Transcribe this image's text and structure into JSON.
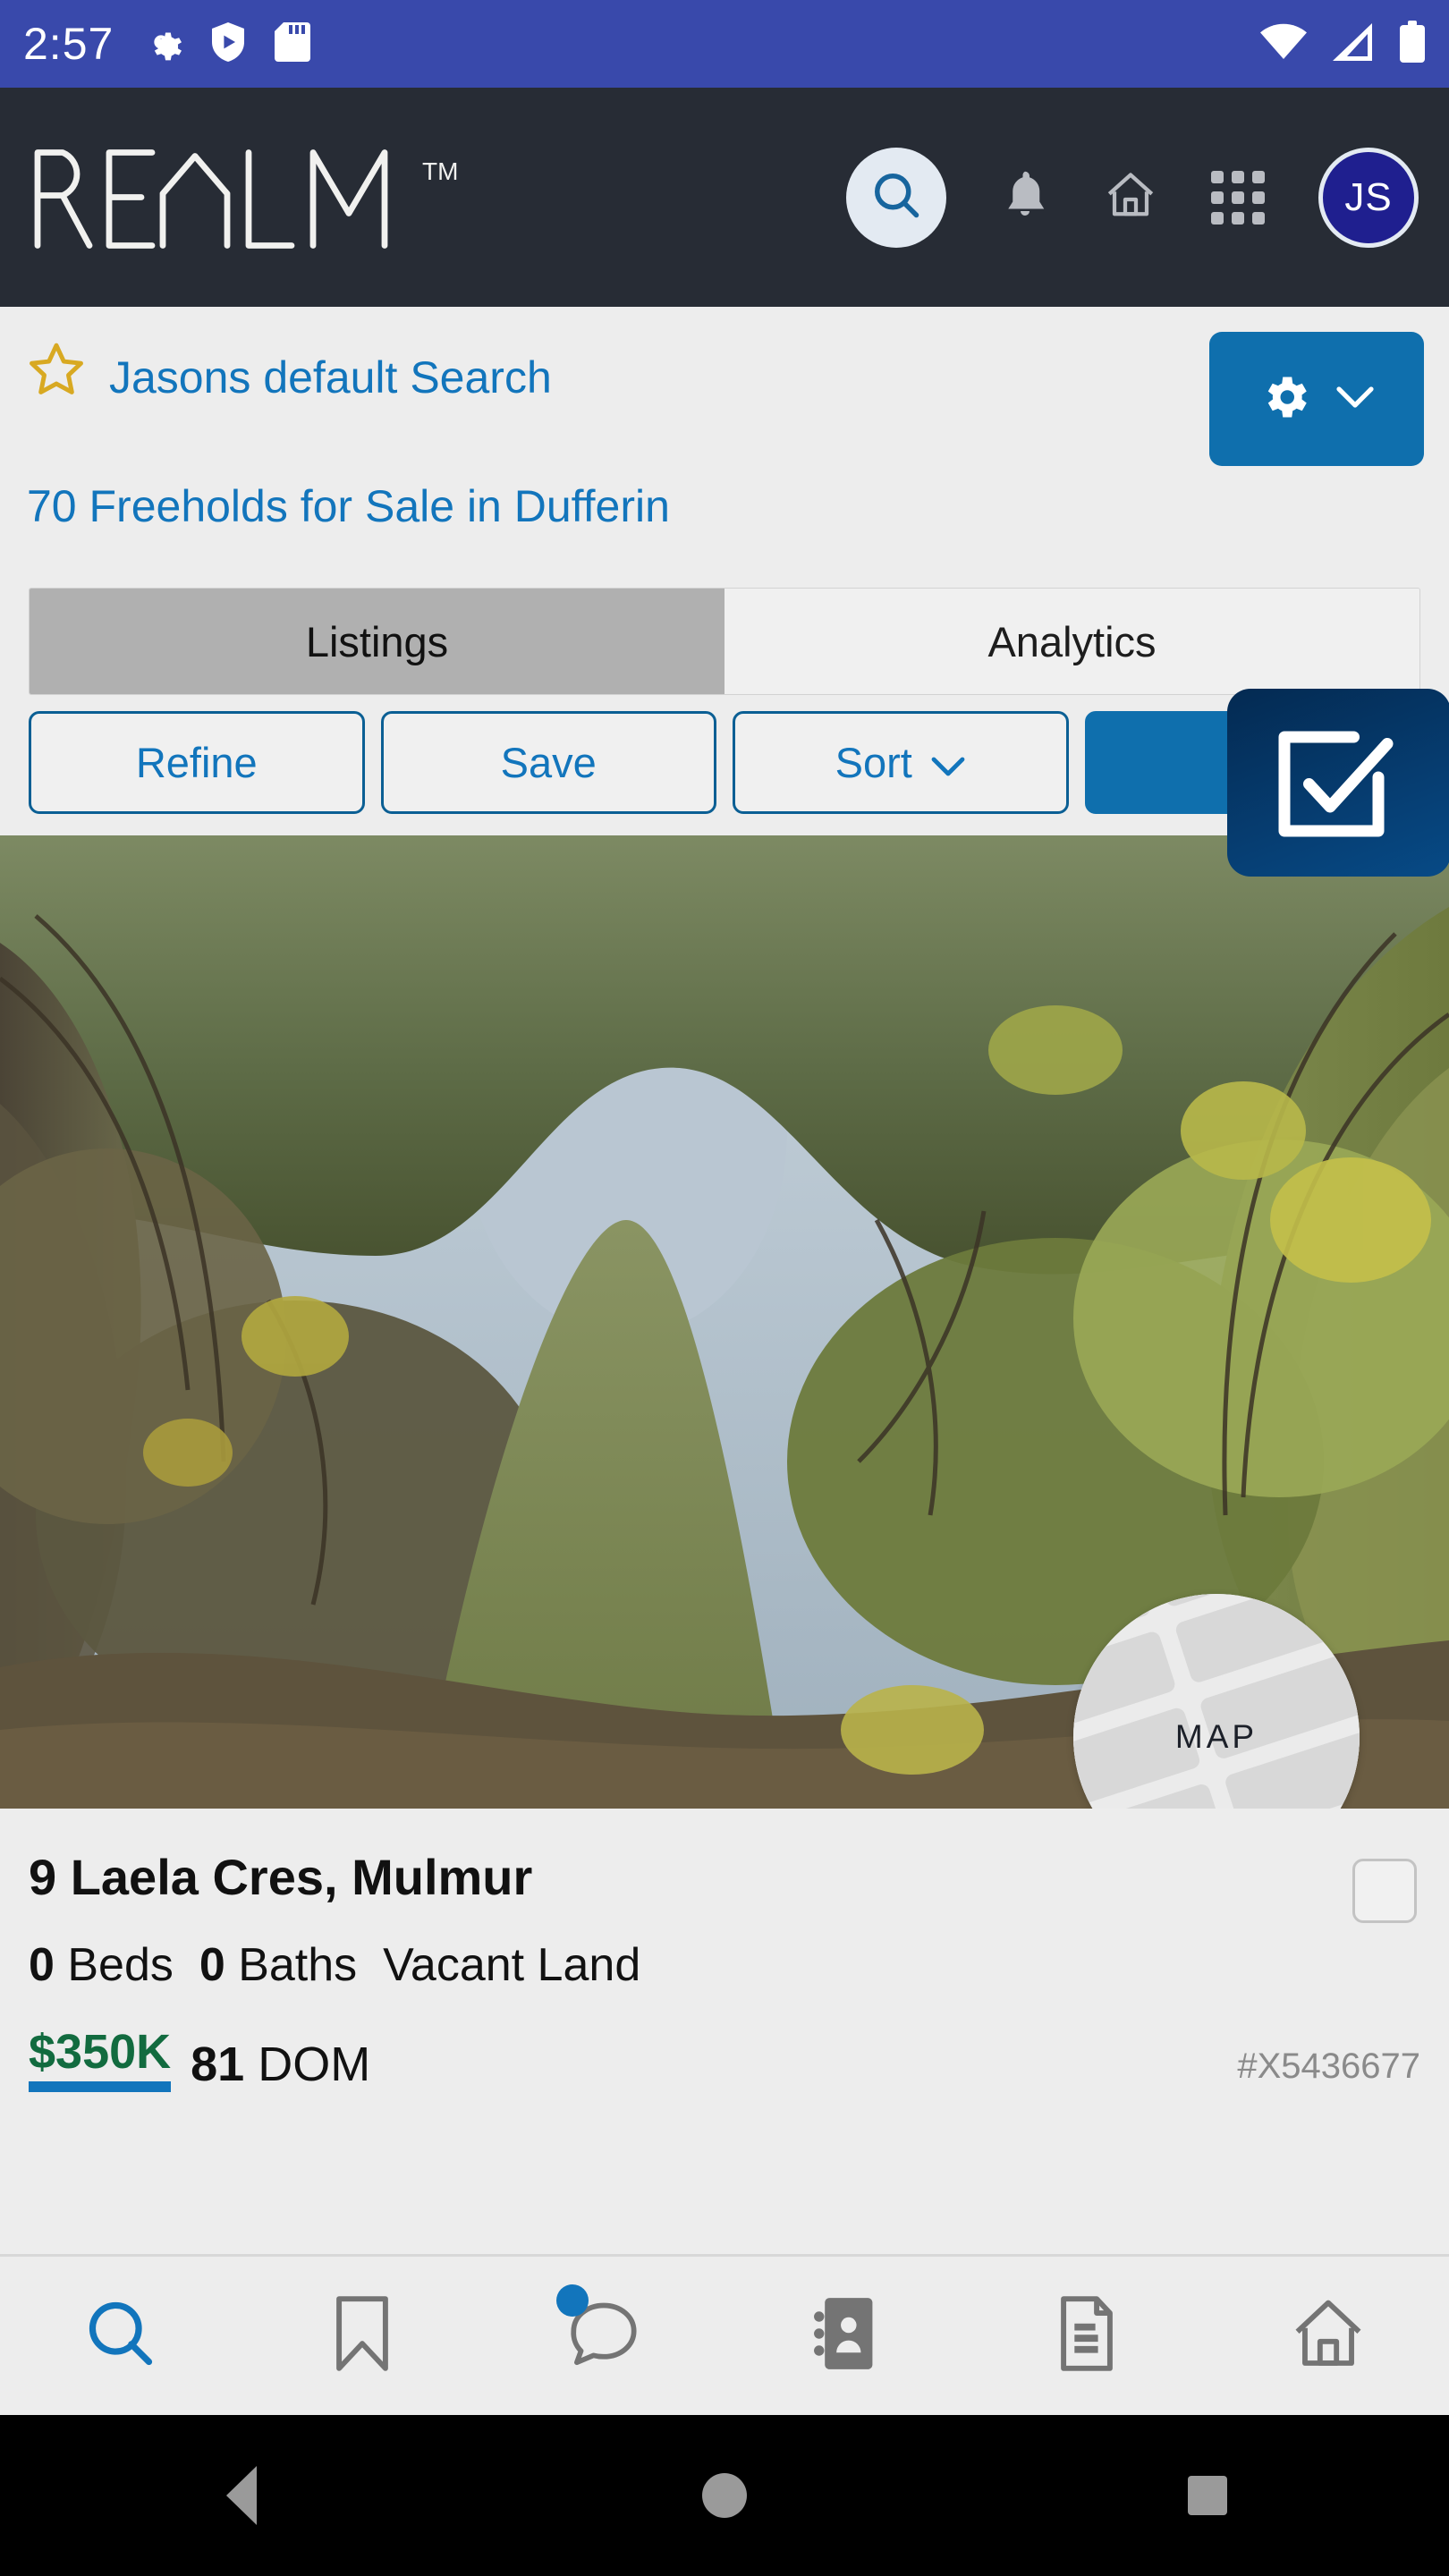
{
  "status_bar": {
    "time": "2:57",
    "left_icons": [
      "gear-icon",
      "shield-play-icon",
      "sd-card-icon"
    ],
    "right_icons": [
      "wifi-icon",
      "cell-signal-icon",
      "battery-icon"
    ],
    "background_color": "#3949ab"
  },
  "app_header": {
    "brand": "REALM",
    "trademark": "TM",
    "background_color": "#272c35",
    "icons": [
      "search-icon",
      "bell-icon",
      "home-icon",
      "apps-grid-icon"
    ],
    "avatar_initials": "JS",
    "avatar_color": "#1f1f8f"
  },
  "saved_search": {
    "star_icon": "star-outline-icon",
    "title": "Jasons default Search",
    "settings_icon": "gear-icon",
    "settings_chevron": "chevron-down-icon",
    "settings_color": "#0f6fad"
  },
  "results": {
    "heading": "70 Freeholds for Sale in Dufferin",
    "count": 70,
    "link_color": "#1275bc"
  },
  "tabs": [
    {
      "label": "Listings",
      "active": true
    },
    {
      "label": "Analytics",
      "active": false
    }
  ],
  "actions": [
    {
      "label": "Refine",
      "style": "outline",
      "icon": null
    },
    {
      "label": "Save",
      "style": "outline",
      "icon": null
    },
    {
      "label": "Sort",
      "style": "outline",
      "icon": "chevron-down-icon"
    },
    {
      "label": "",
      "style": "primary",
      "icon": "select-all-icon"
    }
  ],
  "select_overlay": {
    "icon": "checkbox-checked-icon",
    "background_color": "#063f74"
  },
  "listing": {
    "photo_alt": "overgrown wooded trail",
    "map_button_label": "MAP",
    "address": "9 Laela Cres, Mulmur",
    "beds": "0",
    "beds_label": "Beds",
    "baths": "0",
    "baths_label": "Baths",
    "property_type": "Vacant Land",
    "price": "$350K",
    "dom_value": "81",
    "dom_label": "DOM",
    "mls_id": "#X5436677"
  },
  "bottom_nav": [
    {
      "name": "search",
      "icon": "search-icon",
      "active": true,
      "badge": false
    },
    {
      "name": "saved",
      "icon": "bookmark-icon",
      "active": false,
      "badge": false
    },
    {
      "name": "messages",
      "icon": "chat-bubble-icon",
      "active": false,
      "badge": true
    },
    {
      "name": "contacts",
      "icon": "address-book-icon",
      "active": false,
      "badge": false
    },
    {
      "name": "documents",
      "icon": "document-icon",
      "active": false,
      "badge": false
    },
    {
      "name": "home",
      "icon": "home-icon",
      "active": false,
      "badge": false
    }
  ],
  "android_nav": [
    {
      "name": "back",
      "icon": "triangle-back-icon"
    },
    {
      "name": "home",
      "icon": "circle-home-icon"
    },
    {
      "name": "recents",
      "icon": "square-recents-icon"
    }
  ]
}
